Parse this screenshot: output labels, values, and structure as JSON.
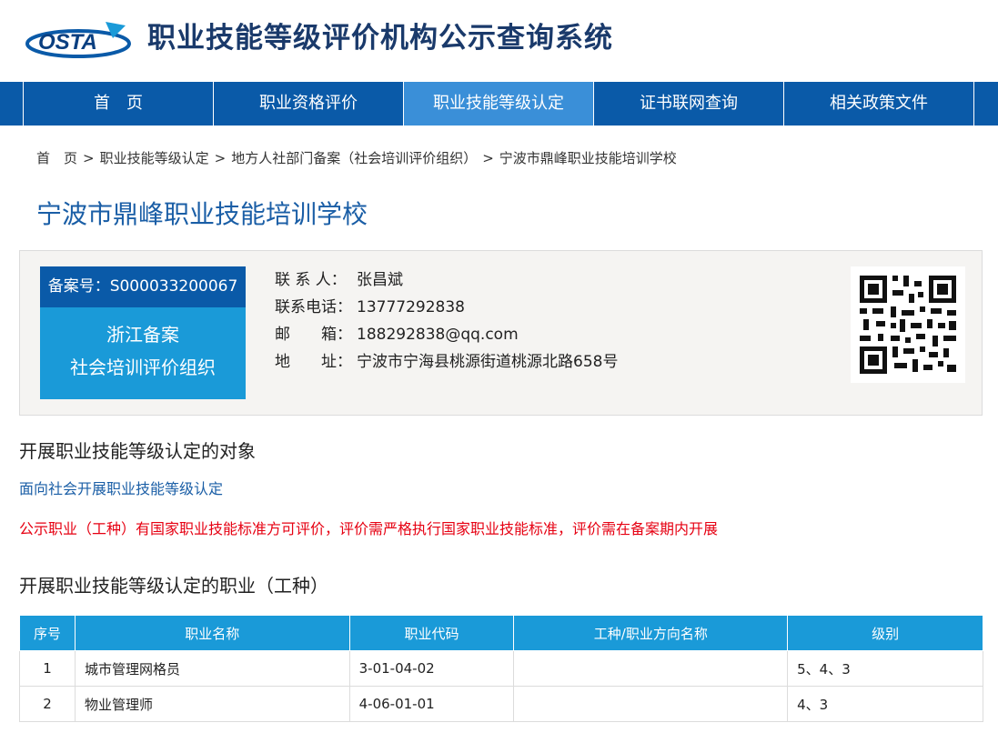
{
  "header": {
    "logo_text": "OSTA",
    "site_title": "职业技能等级评价机构公示查询系统"
  },
  "nav": {
    "items": [
      {
        "label": "首　页"
      },
      {
        "label": "职业资格评价"
      },
      {
        "label": "职业技能等级认定"
      },
      {
        "label": "证书联网查询"
      },
      {
        "label": "相关政策文件"
      }
    ],
    "active_index": 2
  },
  "breadcrumb": {
    "sep": ">",
    "items": [
      "首　页",
      "职业技能等级认定",
      "地方人社部门备案（社会培训评价组织）",
      "宁波市鼎峰职业技能培训学校"
    ]
  },
  "org": {
    "title": "宁波市鼎峰职业技能培训学校",
    "record_no": "备案号：S000033200067",
    "badge_line1": "浙江备案",
    "badge_line2": "社会培训评价组织",
    "contact": [
      {
        "label": "联 系 人：",
        "value": "张昌斌"
      },
      {
        "label": "联系电话：",
        "value": "13777292838"
      },
      {
        "label": "邮　　箱：",
        "value": "188292838@qq.com"
      },
      {
        "label": "地　　址：",
        "value": "宁波市宁海县桃源街道桃源北路658号"
      }
    ]
  },
  "section1": {
    "heading": "开展职业技能等级认定的对象",
    "link": "面向社会开展职业技能等级认定",
    "note": "公示职业（工种）有国家职业技能标准方可评价，评价需严格执行国家职业技能标准，评价需在备案期内开展"
  },
  "section2": {
    "heading": "开展职业技能等级认定的职业（工种）"
  },
  "table": {
    "headers": [
      "序号",
      "职业名称",
      "职业代码",
      "工种/职业方向名称",
      "级别"
    ],
    "rows": [
      [
        "1",
        "城市管理网格员",
        "3-01-04-02",
        "",
        "5、4、3"
      ],
      [
        "2",
        "物业管理师",
        "4-06-01-01",
        "",
        "4、3"
      ]
    ]
  },
  "colors": {
    "nav_bg": "#0a5aa8",
    "nav_active": "#3a8fd8",
    "accent_blue": "#1a9ad8",
    "title_blue": "#1a5ea6",
    "note_red": "#e60012"
  }
}
